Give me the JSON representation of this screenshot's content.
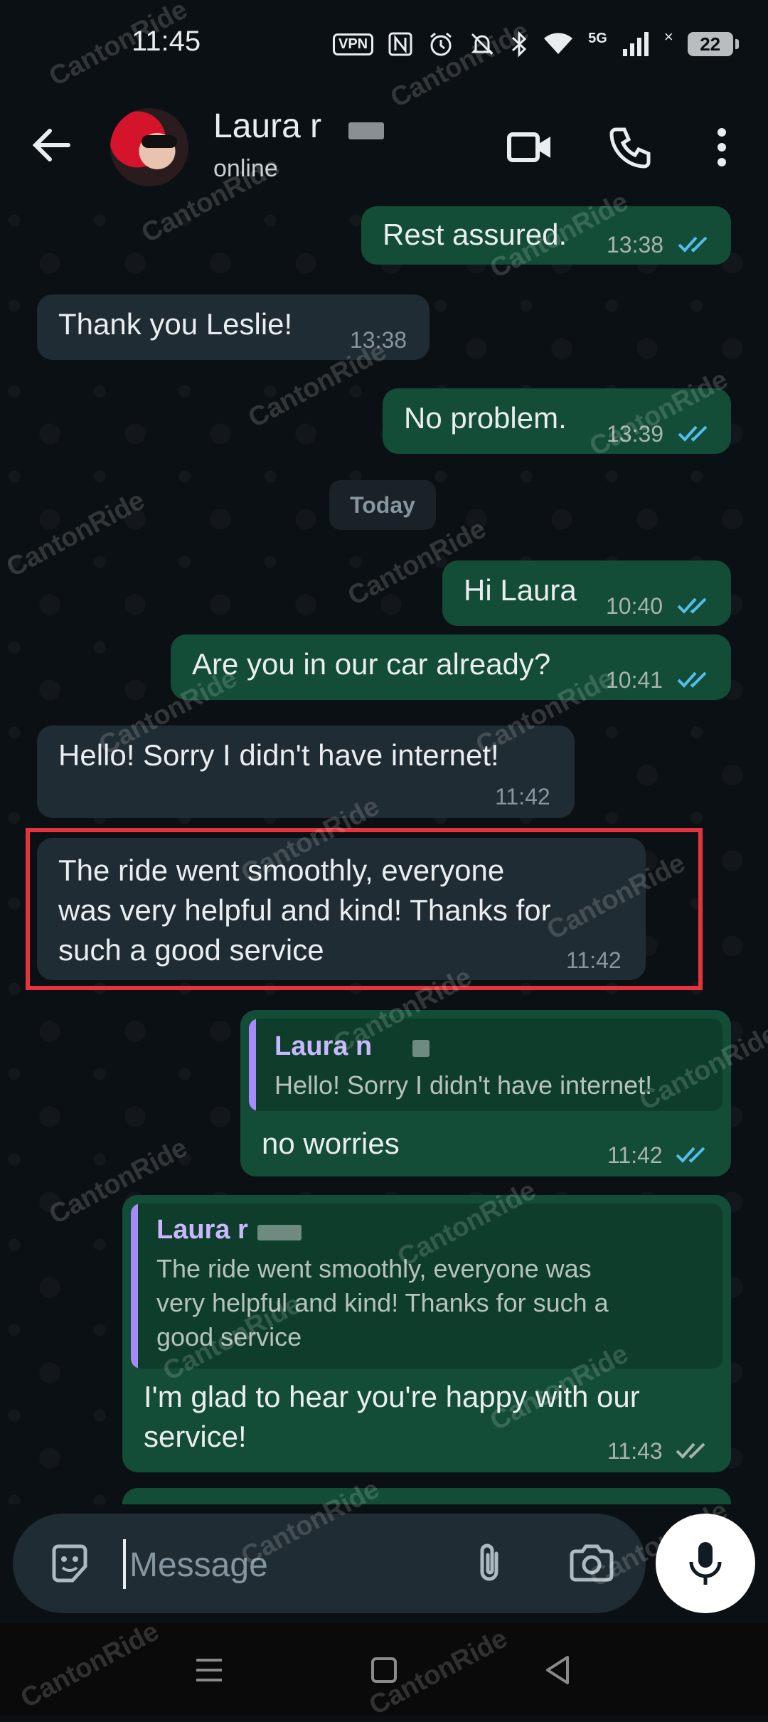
{
  "status_bar": {
    "time": "11:45",
    "vpn_label": "VPN",
    "network_label": "5G",
    "battery_level": "22",
    "icons": [
      "vpn-icon",
      "nfc-icon",
      "alarm-icon",
      "mute-icon",
      "bluetooth-icon",
      "wifi-icon",
      "signal-icon",
      "battery-icon"
    ]
  },
  "header": {
    "contact_name": "Laura r",
    "status": "online",
    "icons": [
      "back-arrow-icon",
      "avatar",
      "video-call-icon",
      "phone-icon",
      "more-vert-icon"
    ]
  },
  "messages": [
    {
      "dir": "out",
      "text": "Rest assured.",
      "time": "13:38",
      "status": "read"
    },
    {
      "dir": "in",
      "text": "Thank you Leslie!",
      "time": "13:38"
    },
    {
      "dir": "out",
      "text": "No problem.",
      "time": "13:39",
      "status": "read"
    },
    {
      "dir": "out",
      "text": "Hi Laura",
      "time": "10:40",
      "status": "read"
    },
    {
      "dir": "out",
      "text": "Are you in our car already?",
      "time": "10:41",
      "status": "read"
    },
    {
      "dir": "in",
      "text": "Hello! Sorry I didn't have internet!",
      "time": "11:42"
    },
    {
      "dir": "in",
      "text": "The ride went smoothly, everyone\nwas very helpful and kind! Thanks for\nsuch a good service",
      "time": "11:42",
      "highlighted": true
    },
    {
      "dir": "out",
      "text": "no worries",
      "time": "11:42",
      "status": "read",
      "quote": {
        "name": "Laura n",
        "text": "Hello! Sorry I didn't have internet!"
      }
    },
    {
      "dir": "out",
      "text": "I'm glad to hear you're happy with our\nservice!",
      "time": "11:43",
      "status": "delivered",
      "quote": {
        "name": "Laura r",
        "text": "The ride went smoothly, everyone was\nvery helpful and kind! Thanks for such a\ngood service"
      }
    }
  ],
  "date_separator": "Today",
  "input": {
    "placeholder": "Message"
  },
  "watermark": "CantonRide",
  "colors": {
    "outgoing": "#134d37",
    "incoming": "#202c33",
    "read_ticks": "#53bdeb",
    "delivered_ticks": "#a9b4ad",
    "highlight_border": "#e5343d",
    "quote_accent": "#a78bfa"
  }
}
